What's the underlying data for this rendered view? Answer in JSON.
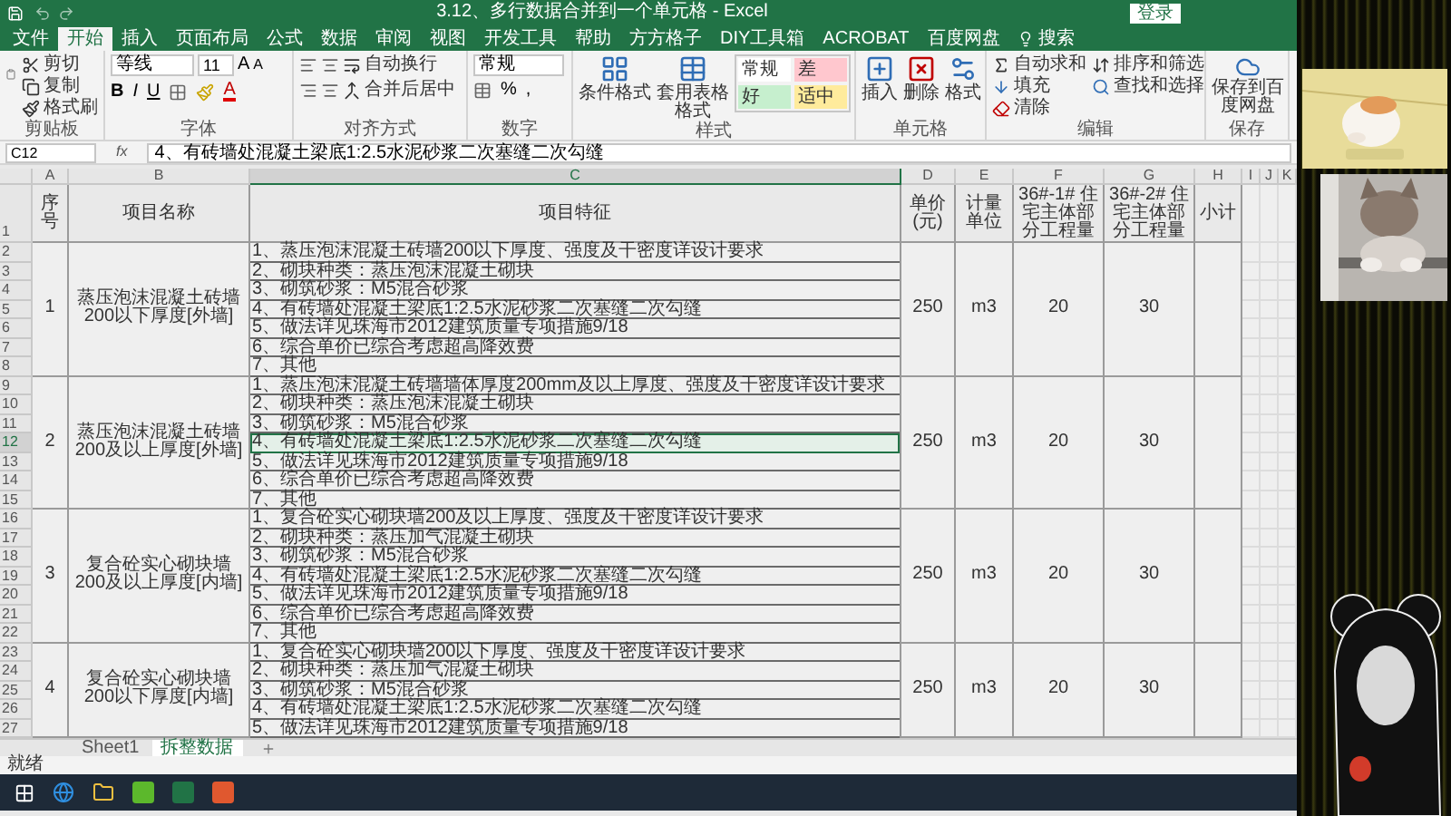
{
  "window": {
    "title": "3.12、多行数据合并到一个单元格 - Excel",
    "login": "登录"
  },
  "menu_tabs": [
    {
      "label": "文件",
      "selected": false
    },
    {
      "label": "开始",
      "selected": true
    },
    {
      "label": "插入",
      "selected": false
    },
    {
      "label": "页面布局",
      "selected": false
    },
    {
      "label": "公式",
      "selected": false
    },
    {
      "label": "数据",
      "selected": false
    },
    {
      "label": "审阅",
      "selected": false
    },
    {
      "label": "视图",
      "selected": false
    },
    {
      "label": "开发工具",
      "selected": false
    },
    {
      "label": "帮助",
      "selected": false
    },
    {
      "label": "方方格子",
      "selected": false
    },
    {
      "label": "DIY工具箱",
      "selected": false
    },
    {
      "label": "ACROBAT",
      "selected": false
    },
    {
      "label": "百度网盘",
      "selected": false
    }
  ],
  "search": "搜索",
  "ribbon_groups": [
    {
      "kind": "clipboard",
      "label": "剪贴板",
      "items": [
        "剪切",
        "复制",
        "格式刷"
      ]
    },
    {
      "kind": "font",
      "label": "字体",
      "items": [
        "等线",
        "11",
        "A",
        "A",
        "B",
        "I",
        "U",
        "A"
      ]
    },
    {
      "kind": "align",
      "label": "对齐方式",
      "items": [
        "自动换行",
        "合并后居中"
      ]
    },
    {
      "kind": "number",
      "label": "数字",
      "items": [
        "常规",
        "%",
        ","
      ]
    },
    {
      "kind": "styles",
      "label": "样式",
      "items": [
        "条件格式",
        "套用表格格式"
      ],
      "cell_styles": [
        {
          "label": "常规",
          "color": "#ffffff"
        },
        {
          "label": "差",
          "color": "#ffc7ce"
        },
        {
          "label": "好",
          "color": "#c6efce"
        },
        {
          "label": "适中",
          "color": "#ffeb9c"
        }
      ]
    },
    {
      "kind": "cells",
      "label": "单元格",
      "items": [
        "插入",
        "删除",
        "格式"
      ]
    },
    {
      "kind": "editing",
      "label": "编辑",
      "items": [
        "自动求和",
        "填充",
        "清除",
        "排序和筛选",
        "查找和选择"
      ]
    },
    {
      "kind": "save",
      "label": "保存",
      "items": [
        "保存到百度网盘"
      ]
    }
  ],
  "formula_bar": {
    "name_box": "C12",
    "fx": "fx",
    "value": "4、有砖墙处混凝土梁底1:2.5水泥砂浆二次塞缝二次勾缝"
  },
  "columns": [
    {
      "label": "A",
      "selected": false
    },
    {
      "label": "B",
      "selected": false
    },
    {
      "label": "C",
      "selected": true
    },
    {
      "label": "D",
      "selected": false
    },
    {
      "label": "E",
      "selected": false
    },
    {
      "label": "F",
      "selected": false
    },
    {
      "label": "G",
      "selected": false
    },
    {
      "label": "H",
      "selected": false
    },
    {
      "label": "I",
      "selected": false
    },
    {
      "label": "J",
      "selected": false
    },
    {
      "label": "K",
      "selected": false
    }
  ],
  "header_row": {
    "row": "1",
    "cells": [
      "序号",
      "项目名称",
      "项目特征",
      "单价(元)",
      "计量单位",
      "36#-1# 住宅主体部分工程量",
      "36#-2# 住宅主体部分工程量",
      "小计"
    ]
  },
  "items": [
    {
      "no": "1",
      "name": "蒸压泡沫混凝土砖墙200以下厚度[外墙]",
      "price": "250",
      "unit": "m3",
      "qty1": "20",
      "qty2": "30",
      "rows": [
        "2",
        "3",
        "4",
        "5",
        "6",
        "7",
        "8"
      ],
      "features": [
        {
          "text": "1、蒸压泡沫混凝土砖墙200以下厚度、强度及干密度详设计要求",
          "selected": false
        },
        {
          "text": "2、砌块种类：蒸压泡沫混凝土砌块",
          "selected": false
        },
        {
          "text": "3、砌筑砂浆：M5混合砂浆",
          "selected": false
        },
        {
          "text": "4、有砖墙处混凝土梁底1:2.5水泥砂浆二次塞缝二次勾缝",
          "selected": false
        },
        {
          "text": "5、做法详见珠海市2012建筑质量专项措施9/18",
          "selected": false
        },
        {
          "text": "6、综合单价已综合考虑超高降效费",
          "selected": false
        },
        {
          "text": "7、其他",
          "selected": false
        }
      ]
    },
    {
      "no": "2",
      "name": "蒸压泡沫混凝土砖墙200及以上厚度[外墙]",
      "price": "250",
      "unit": "m3",
      "qty1": "20",
      "qty2": "30",
      "rows": [
        "9",
        "10",
        "11",
        "12",
        "13",
        "14",
        "15"
      ],
      "features": [
        {
          "text": "1、蒸压泡沫混凝土砖墙墙体厚度200mm及以上厚度、强度及干密度详设计要求",
          "selected": false
        },
        {
          "text": "2、砌块种类：蒸压泡沫混凝土砌块",
          "selected": false
        },
        {
          "text": "3、砌筑砂浆：M5混合砂浆",
          "selected": false
        },
        {
          "text": "4、有砖墙处混凝土梁底1:2.5水泥砂浆二次塞缝二次勾缝",
          "selected": true
        },
        {
          "text": "5、做法详见珠海市2012建筑质量专项措施9/18",
          "selected": false
        },
        {
          "text": "6、综合单价已综合考虑超高降效费",
          "selected": false
        },
        {
          "text": "7、其他",
          "selected": false
        }
      ]
    },
    {
      "no": "3",
      "name": "复合砼实心砌块墙200及以上厚度[内墙]",
      "price": "250",
      "unit": "m3",
      "qty1": "20",
      "qty2": "30",
      "rows": [
        "16",
        "17",
        "18",
        "19",
        "20",
        "21",
        "22"
      ],
      "features": [
        {
          "text": "1、复合砼实心砌块墙200及以上厚度、强度及干密度详设计要求",
          "selected": false
        },
        {
          "text": "2、砌块种类：蒸压加气混凝土砌块",
          "selected": false
        },
        {
          "text": "3、砌筑砂浆：M5混合砂浆",
          "selected": false
        },
        {
          "text": "4、有砖墙处混凝土梁底1:2.5水泥砂浆二次塞缝二次勾缝",
          "selected": false
        },
        {
          "text": "5、做法详见珠海市2012建筑质量专项措施9/18",
          "selected": false
        },
        {
          "text": "6、综合单价已综合考虑超高降效费",
          "selected": false
        },
        {
          "text": "7、其他",
          "selected": false
        }
      ]
    },
    {
      "no": "4",
      "name": "复合砼实心砌块墙200以下厚度[内墙]",
      "price": "250",
      "unit": "m3",
      "qty1": "20",
      "qty2": "30",
      "rows": [
        "23",
        "24",
        "25",
        "26",
        "27"
      ],
      "features": [
        {
          "text": "1、复合砼实心砌块墙200以下厚度、强度及干密度详设计要求",
          "selected": false
        },
        {
          "text": "2、砌块种类：蒸压加气混凝土砌块",
          "selected": false
        },
        {
          "text": "3、砌筑砂浆：M5混合砂浆",
          "selected": false
        },
        {
          "text": "4、有砖墙处混凝土梁底1:2.5水泥砂浆二次塞缝二次勾缝",
          "selected": false
        },
        {
          "text": "5、做法详见珠海市2012建筑质量专项措施9/18",
          "selected": false
        }
      ]
    }
  ],
  "sheet_tabs": [
    {
      "label": "Sheet1",
      "selected": false
    },
    {
      "label": "拆整数据",
      "selected": true
    }
  ],
  "status_bar": {
    "text": "就绪"
  }
}
